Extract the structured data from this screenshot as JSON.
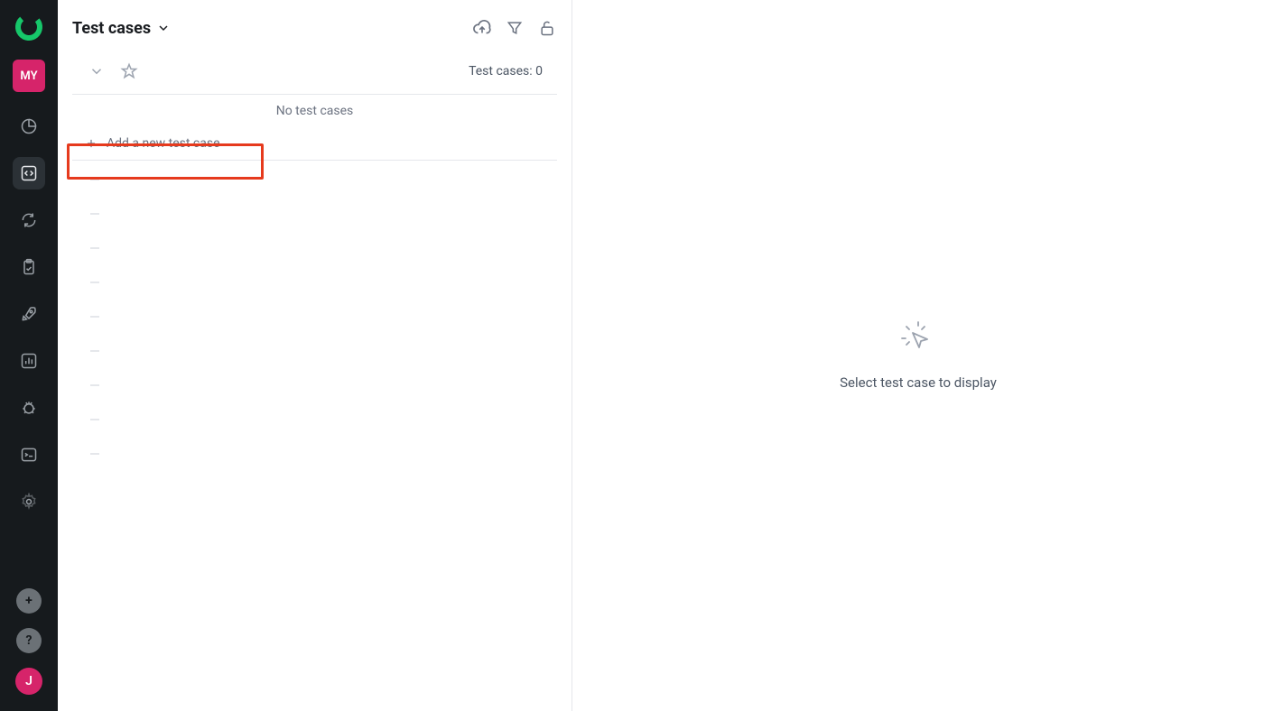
{
  "sidebar": {
    "project_badge": "MY",
    "avatar_letter": "J"
  },
  "panel": {
    "title": "Test cases",
    "count_label": "Test cases: 0",
    "empty_label": "No test cases",
    "add_label": "Add a new test case"
  },
  "detail": {
    "placeholder": "Select test case to display"
  }
}
